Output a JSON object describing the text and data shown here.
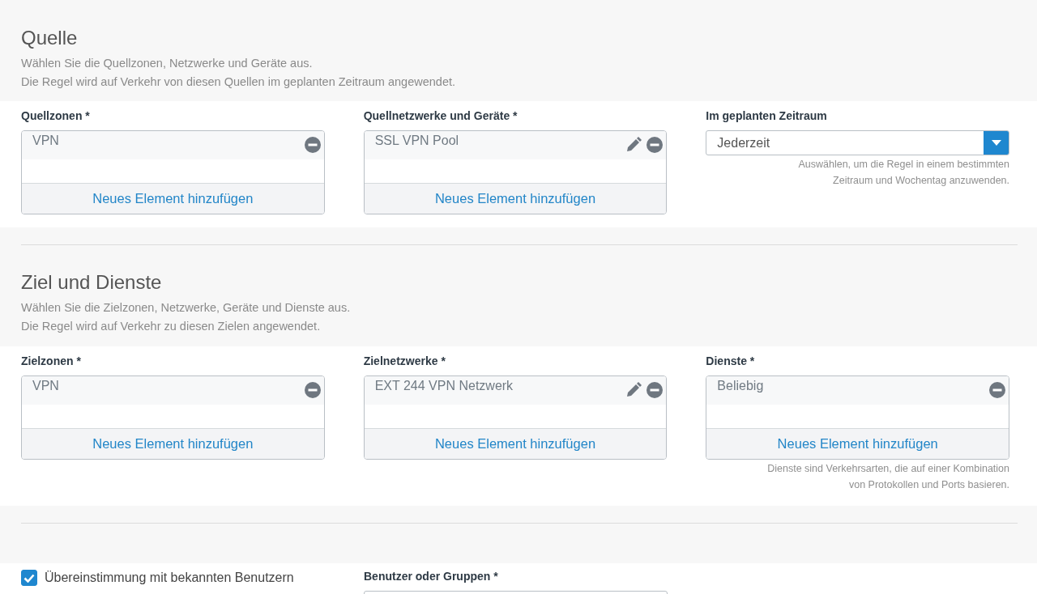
{
  "sections": [
    {
      "title": "Quelle",
      "description": [
        "Wählen Sie die Quellzonen, Netzwerke und Geräte aus.",
        "Die Regel wird auf Verkehr von diesen Quellen im geplanten Zeitraum angewendet."
      ],
      "fields": [
        {
          "kind": "list",
          "label": "Quellzonen *",
          "items": [
            {
              "text": "VPN",
              "editable": false
            }
          ],
          "add": "Neues Element hinzufügen"
        },
        {
          "kind": "list",
          "label": "Quellnetzwerke und Geräte *",
          "items": [
            {
              "text": "SSL VPN Pool",
              "editable": true
            }
          ],
          "add": "Neues Element hinzufügen"
        },
        {
          "kind": "select",
          "label": "Im geplanten Zeitraum",
          "value": "Jederzeit",
          "hint": [
            "Auswählen, um die Regel in einem bestimmten",
            "Zeitraum und Wochentag anzuwenden."
          ]
        }
      ]
    },
    {
      "title": "Ziel und Dienste",
      "description": [
        "Wählen Sie die Zielzonen, Netzwerke, Geräte und Dienste aus.",
        "Die Regel wird auf Verkehr zu diesen Zielen angewendet."
      ],
      "fields": [
        {
          "kind": "list",
          "label": "Zielzonen *",
          "items": [
            {
              "text": "VPN",
              "editable": false
            }
          ],
          "add": "Neues Element hinzufügen"
        },
        {
          "kind": "list",
          "label": "Zielnetzwerke *",
          "items": [
            {
              "text": "EXT 244 VPN Netzwerk",
              "editable": true
            }
          ],
          "add": "Neues Element hinzufügen"
        },
        {
          "kind": "list",
          "label": "Dienste *",
          "items": [
            {
              "text": "Beliebig",
              "editable": false
            }
          ],
          "add": "Neues Element hinzufügen",
          "hint": [
            "Dienste sind Verkehrsarten, die auf einer Kombination",
            "von Protokollen und Ports basieren."
          ]
        }
      ]
    }
  ],
  "users": {
    "checkbox": {
      "label": "Übereinstimmung mit bekannten Benutzern",
      "checked": true
    },
    "field_label": "Benutzer oder Gruppen *"
  }
}
